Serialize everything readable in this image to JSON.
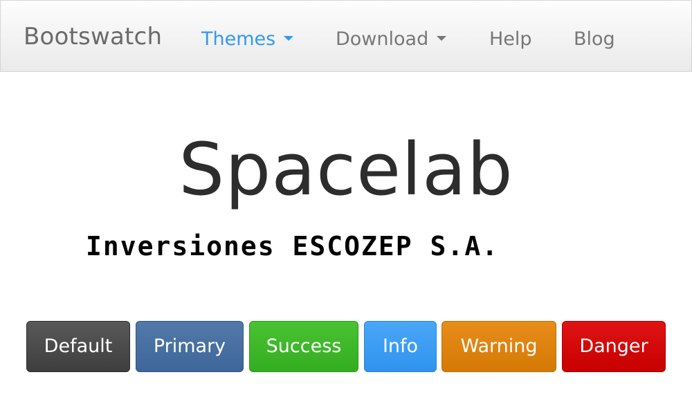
{
  "navbar": {
    "brand": "Bootswatch",
    "items": [
      {
        "label": "Themes",
        "active": true,
        "dropdown": true
      },
      {
        "label": "Download",
        "active": false,
        "dropdown": true
      },
      {
        "label": "Help",
        "active": false,
        "dropdown": false
      },
      {
        "label": "Blog",
        "active": false,
        "dropdown": false
      }
    ]
  },
  "hero": {
    "title": "Spacelab",
    "subtitle": "Inversiones ESCOZEP S.A."
  },
  "buttons": [
    {
      "label": "Default",
      "color": "#474747"
    },
    {
      "label": "Primary",
      "color": "#446e9b"
    },
    {
      "label": "Success",
      "color": "#3cb521"
    },
    {
      "label": "Info",
      "color": "#3399f3"
    },
    {
      "label": "Warning",
      "color": "#d47500"
    },
    {
      "label": "Danger",
      "color": "#cd0200"
    }
  ],
  "colors": {
    "accent": "#3399f3",
    "nav_text": "#777777",
    "brand_text": "#6a6a6a"
  }
}
